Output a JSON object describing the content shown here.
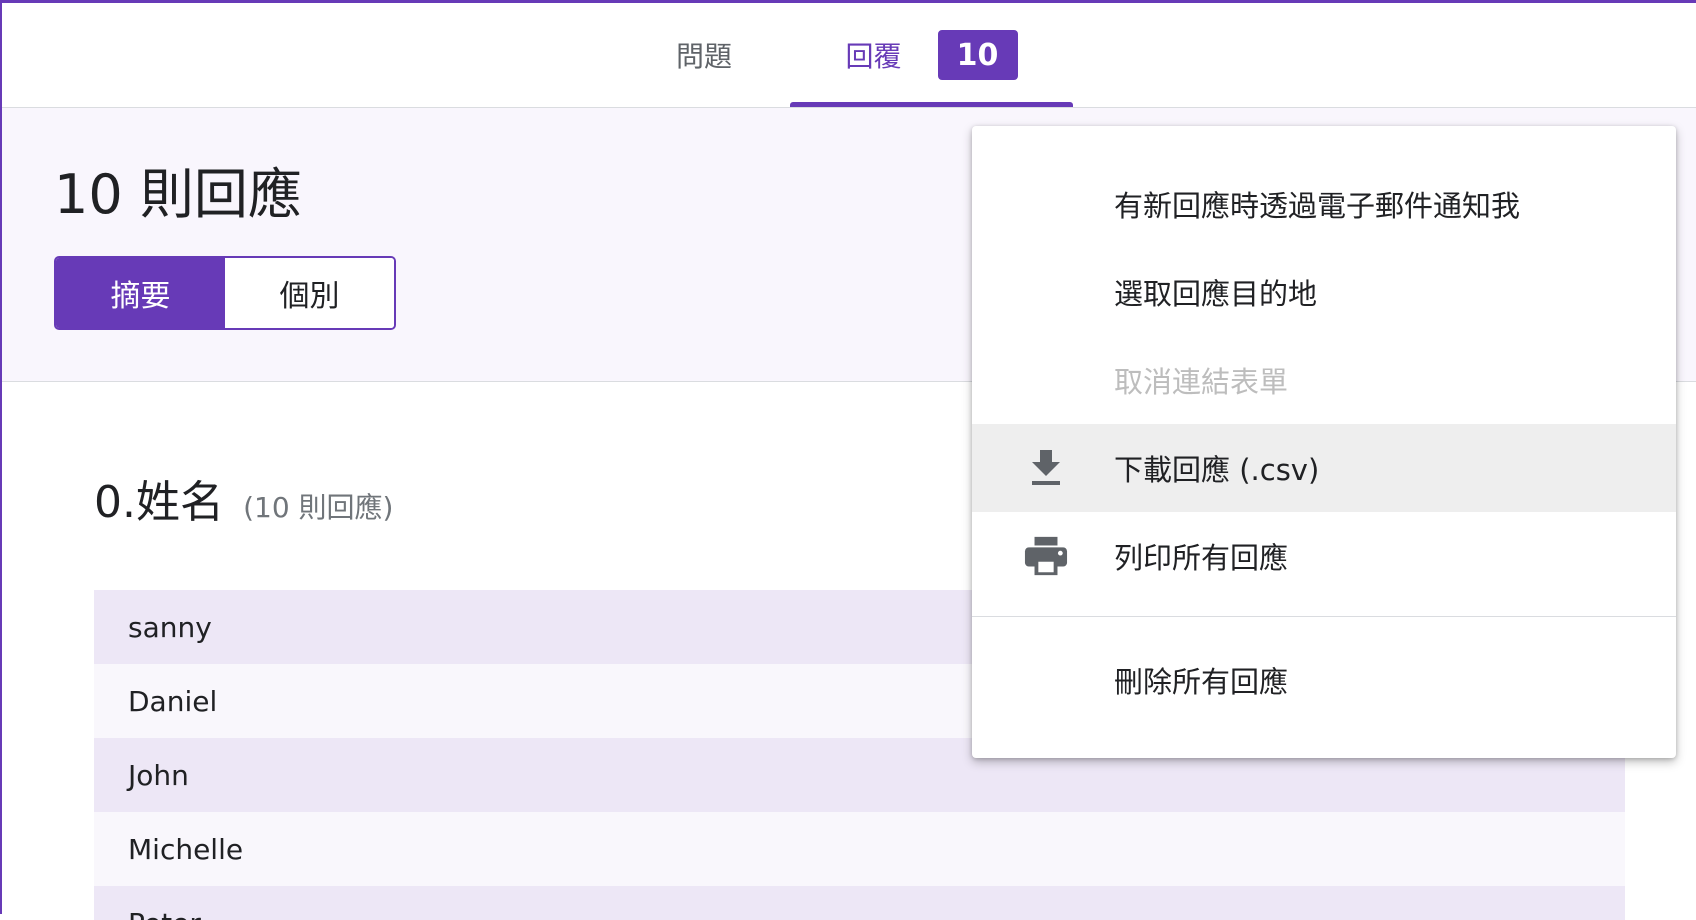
{
  "tabs": {
    "questions_label": "問題",
    "responses_label": "回覆",
    "responses_count": "10"
  },
  "summary": {
    "title": "10 則回應",
    "summary_label": "摘要",
    "individual_label": "個別"
  },
  "question": {
    "title": "0.姓名",
    "count_text": "(10 則回應)",
    "answers": [
      "sanny",
      "Daniel",
      "John",
      "Michelle",
      "Peter"
    ]
  },
  "menu": {
    "items": [
      {
        "label": "有新回應時透過電子郵件通知我",
        "icon": "",
        "disabled": false
      },
      {
        "label": "選取回應目的地",
        "icon": "",
        "disabled": false
      },
      {
        "label": "取消連結表單",
        "icon": "",
        "disabled": true
      },
      {
        "label": "下載回應 (.csv)",
        "icon": "download-icon",
        "disabled": false
      },
      {
        "label": "列印所有回應",
        "icon": "print-icon",
        "disabled": false
      },
      {
        "label": "刪除所有回應",
        "icon": "",
        "disabled": false
      }
    ]
  },
  "colors": {
    "accent": "#673ab7",
    "row_odd": "#ede7f6",
    "row_even": "#f9f7fc",
    "disabled_text": "#bdbdbd"
  }
}
